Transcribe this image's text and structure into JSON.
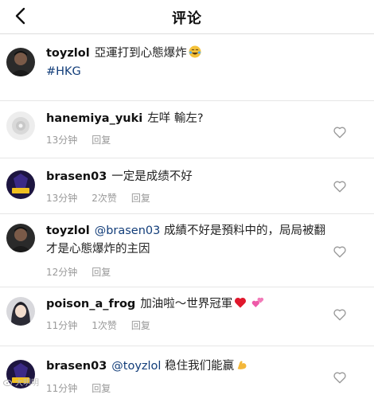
{
  "header": {
    "title": "评论"
  },
  "colors": {
    "link": "#123d79",
    "meta": "#999999",
    "divider": "#e6e6e6"
  },
  "comments": [
    {
      "username": "toyzlol",
      "text": "亞運打到心態爆炸",
      "emoji": "laughing-tears",
      "hashtag": "#HKG",
      "avatar": "dark-portrait"
    },
    {
      "username": "hanemiya_yuki",
      "text": "左咩 輸左?",
      "time": "13分钟",
      "reply": "回复",
      "avatar": "light-floral"
    },
    {
      "username": "brasen03",
      "text": "一定是成绩不好",
      "time": "13分钟",
      "likes": "2次赞",
      "reply": "回复",
      "avatar": "team-logo"
    },
    {
      "username": "toyzlol",
      "mention": "@brasen03",
      "text": "成績不好是預料中的，局局被翻才是心態爆炸的主因",
      "time": "12分钟",
      "reply": "回复",
      "avatar": "dark-portrait"
    },
    {
      "username": "poison_a_frog",
      "text": "加油啦～世界冠軍",
      "emoji": "hearts",
      "time": "11分钟",
      "likes": "1次赞",
      "reply": "回复",
      "avatar": "anime-portrait"
    },
    {
      "username": "brasen03",
      "mention": "@toyzlol",
      "text": "稳住我们能赢",
      "emoji": "flexed-biceps",
      "time": "11分钟",
      "reply": "回复",
      "avatar": "team-logo"
    }
  ],
  "watermark": "大明明"
}
